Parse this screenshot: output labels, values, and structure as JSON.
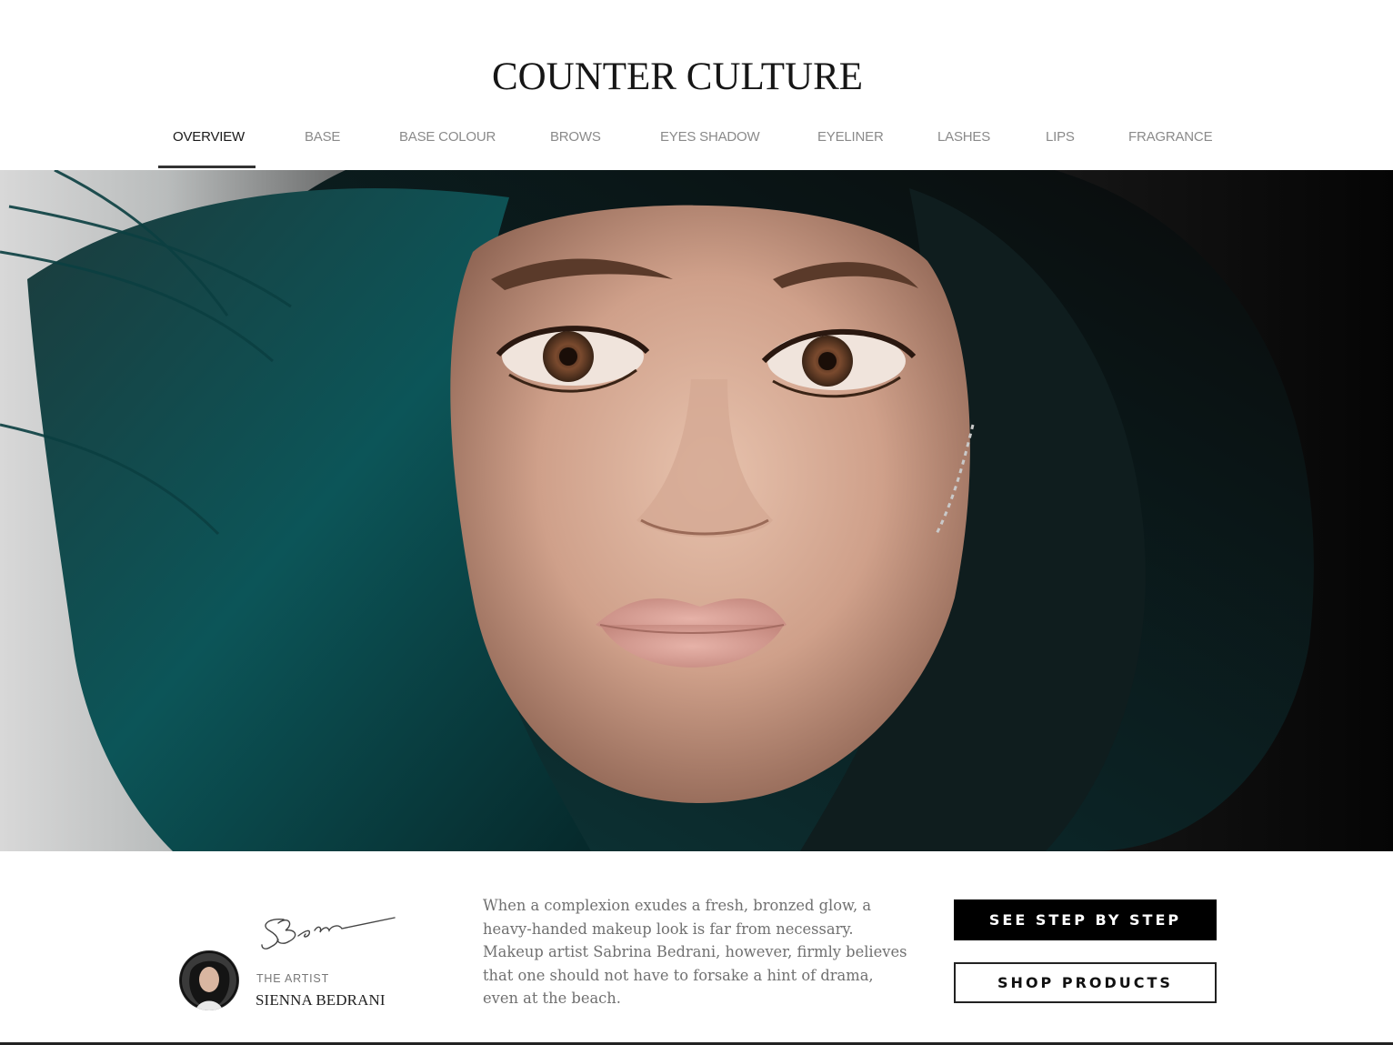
{
  "header": {
    "brand": "COUNTER CULTURE"
  },
  "nav": {
    "active": "OVERVIEW",
    "items": [
      {
        "label": "OVERVIEW",
        "active": true
      },
      {
        "label": "BASE",
        "active": false
      },
      {
        "label": "BASE COLOUR",
        "active": false
      },
      {
        "label": "BROWS",
        "active": false
      },
      {
        "label": "EYES SHADOW",
        "active": false
      },
      {
        "label": "EYELINER",
        "active": false
      },
      {
        "label": "LASHES",
        "active": false
      },
      {
        "label": "LIPS",
        "active": false
      },
      {
        "label": "FRAGRANCE",
        "active": false
      }
    ]
  },
  "hero": {
    "image": "close-up portrait of a woman with teal hair"
  },
  "artist": {
    "label": "THE ARTIST",
    "name": "SIENNA BEDRANI"
  },
  "description": "When a complexion exudes a fresh, bronzed glow, a heavy-handed makeup look is far from necessary. Makeup artist Sabrina Bedrani, however, firmly believes that one should not have to forsake a hint of drama, even at the beach.",
  "actions": {
    "primary_label": "SEE STEP BY STEP",
    "secondary_label": "SHOP PRODUCTS"
  },
  "colors": {
    "accent": "#000000",
    "hair": "#0f4a4c",
    "nav_inactive": "#8a8a8a"
  }
}
